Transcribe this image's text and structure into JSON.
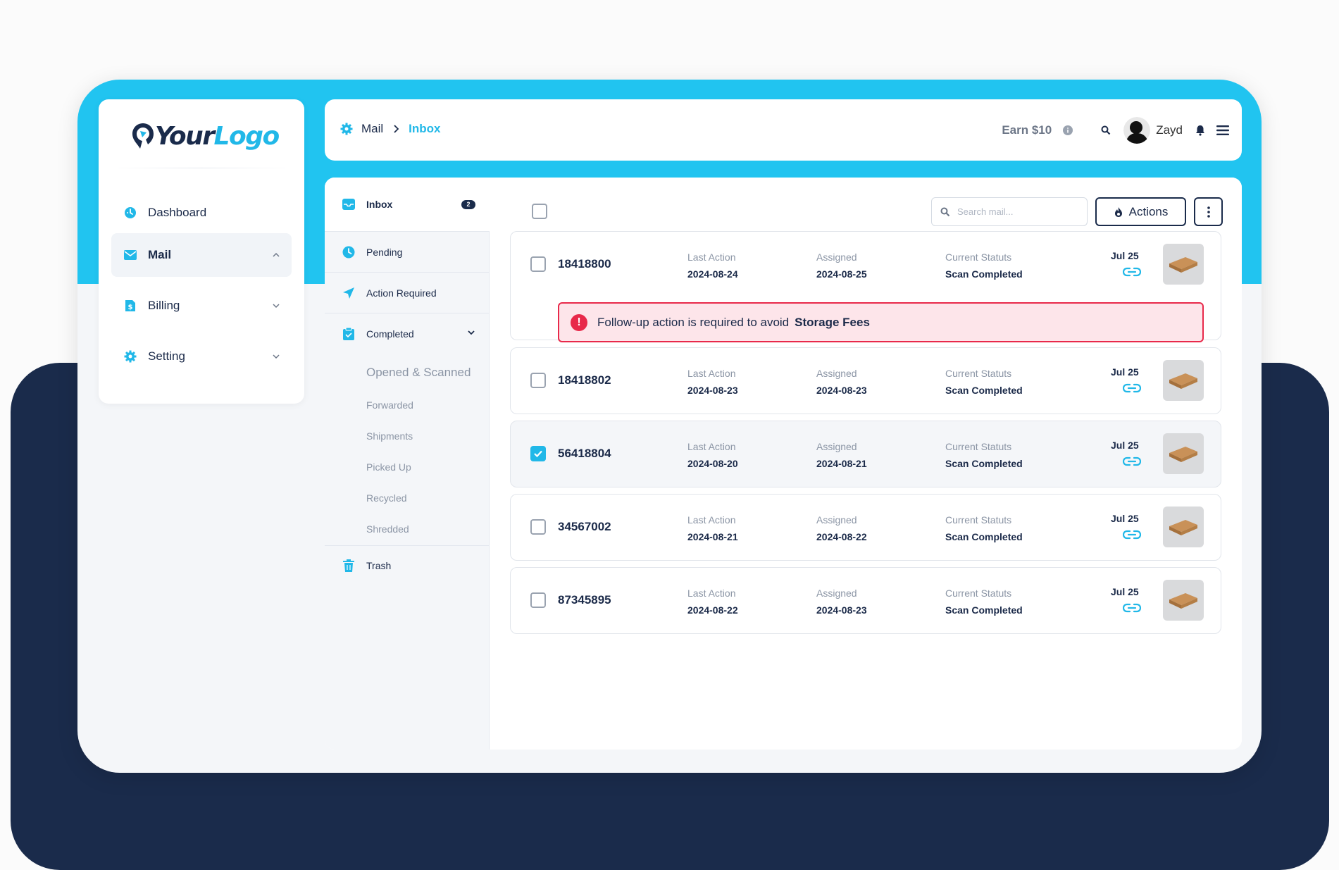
{
  "brand": {
    "logo_part1": "Your",
    "logo_part2": "Logo"
  },
  "sidebar": {
    "items": [
      {
        "label": "Dashboard"
      },
      {
        "label": "Mail"
      },
      {
        "label": "Billing"
      },
      {
        "label": "Setting"
      }
    ]
  },
  "topbar": {
    "breadcrumb_parent": "Mail",
    "breadcrumb_current": "Inbox",
    "earn_label": "Earn $10",
    "user_name": "Zayd"
  },
  "folders": {
    "inbox": {
      "label": "Inbox",
      "count": "2"
    },
    "pending": "Pending",
    "action_required": "Action Required",
    "completed": "Completed",
    "subfolders": [
      "Opened & Scanned",
      "Forwarded",
      "Shipments",
      "Picked Up",
      "Recycled",
      "Shredded"
    ],
    "trash": "Trash"
  },
  "toolbar": {
    "search_placeholder": "Search mail...",
    "actions_label": "Actions"
  },
  "mail_rows": [
    {
      "id": "18418800",
      "last_action_label": "Last Action",
      "last_action": "2024-08-24",
      "assigned_label": "Assigned",
      "assigned": "2024-08-25",
      "status_label": "Current Statuts",
      "status": "Scan Completed",
      "date": "Jul 25",
      "checked": false,
      "alert": {
        "text": "Follow-up action is required to avoid",
        "emphasis": "Storage Fees"
      }
    },
    {
      "id": "18418802",
      "last_action_label": "Last Action",
      "last_action": "2024-08-23",
      "assigned_label": "Assigned",
      "assigned": "2024-08-23",
      "status_label": "Current Statuts",
      "status": "Scan Completed",
      "date": "Jul 25",
      "checked": false
    },
    {
      "id": "56418804",
      "last_action_label": "Last Action",
      "last_action": "2024-08-20",
      "assigned_label": "Assigned",
      "assigned": "2024-08-21",
      "status_label": "Current Statuts",
      "status": "Scan Completed",
      "date": "Jul 25",
      "checked": true
    },
    {
      "id": "34567002",
      "last_action_label": "Last Action",
      "last_action": "2024-08-21",
      "assigned_label": "Assigned",
      "assigned": "2024-08-22",
      "status_label": "Current Statuts",
      "status": "Scan Completed",
      "date": "Jul 25",
      "checked": false
    },
    {
      "id": "87345895",
      "last_action_label": "Last Action",
      "last_action": "2024-08-22",
      "assigned_label": "Assigned",
      "assigned": "2024-08-23",
      "status_label": "Current Statuts",
      "status": "Scan Completed",
      "date": "Jul 25",
      "checked": false
    }
  ],
  "colors": {
    "accent": "#21c4f0",
    "navy": "#1a2b4b",
    "alert": "#e8294a",
    "alert_bg": "#fde5ea"
  },
  "icons": [
    "dashboard-icon",
    "mail-icon",
    "billing-icon",
    "setting-icon",
    "gear-icon",
    "search-icon",
    "bell-icon",
    "menu-icon",
    "inbox-icon",
    "clock-icon",
    "send-icon",
    "clipboard-icon",
    "trash-icon",
    "link-icon",
    "flame-icon",
    "more-icon"
  ]
}
